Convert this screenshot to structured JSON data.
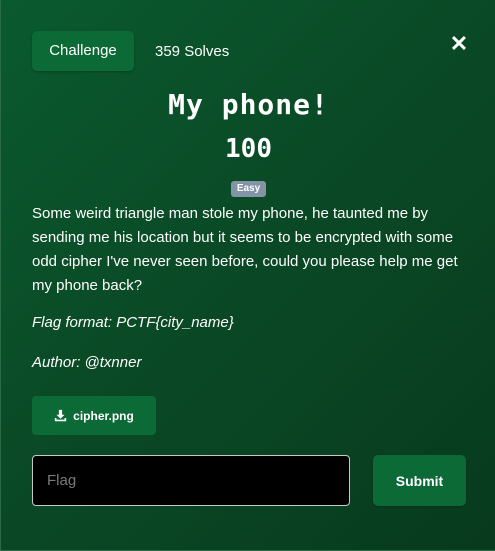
{
  "header": {
    "tab_label": "Challenge",
    "solves": "359 Solves",
    "close_glyph": "✕"
  },
  "challenge": {
    "name": "My phone!",
    "points": "100",
    "difficulty": "Easy",
    "description": "Some weird triangle man stole my phone, he taunted me by sending me his location but it seems to be encrypted with some odd cipher I've never seen before, could you please help me get my phone back?",
    "flag_format": "Flag format: PCTF{city_name}",
    "author": "Author: @txnner"
  },
  "attachment": {
    "icon": "download-icon",
    "filename": "cipher.png"
  },
  "submission": {
    "placeholder": "Flag",
    "value": "",
    "submit_label": "Submit"
  },
  "colors": {
    "background": "#0a4a26",
    "button": "#0b6a35",
    "badge": "#8494a6",
    "input_background": "#000000"
  }
}
